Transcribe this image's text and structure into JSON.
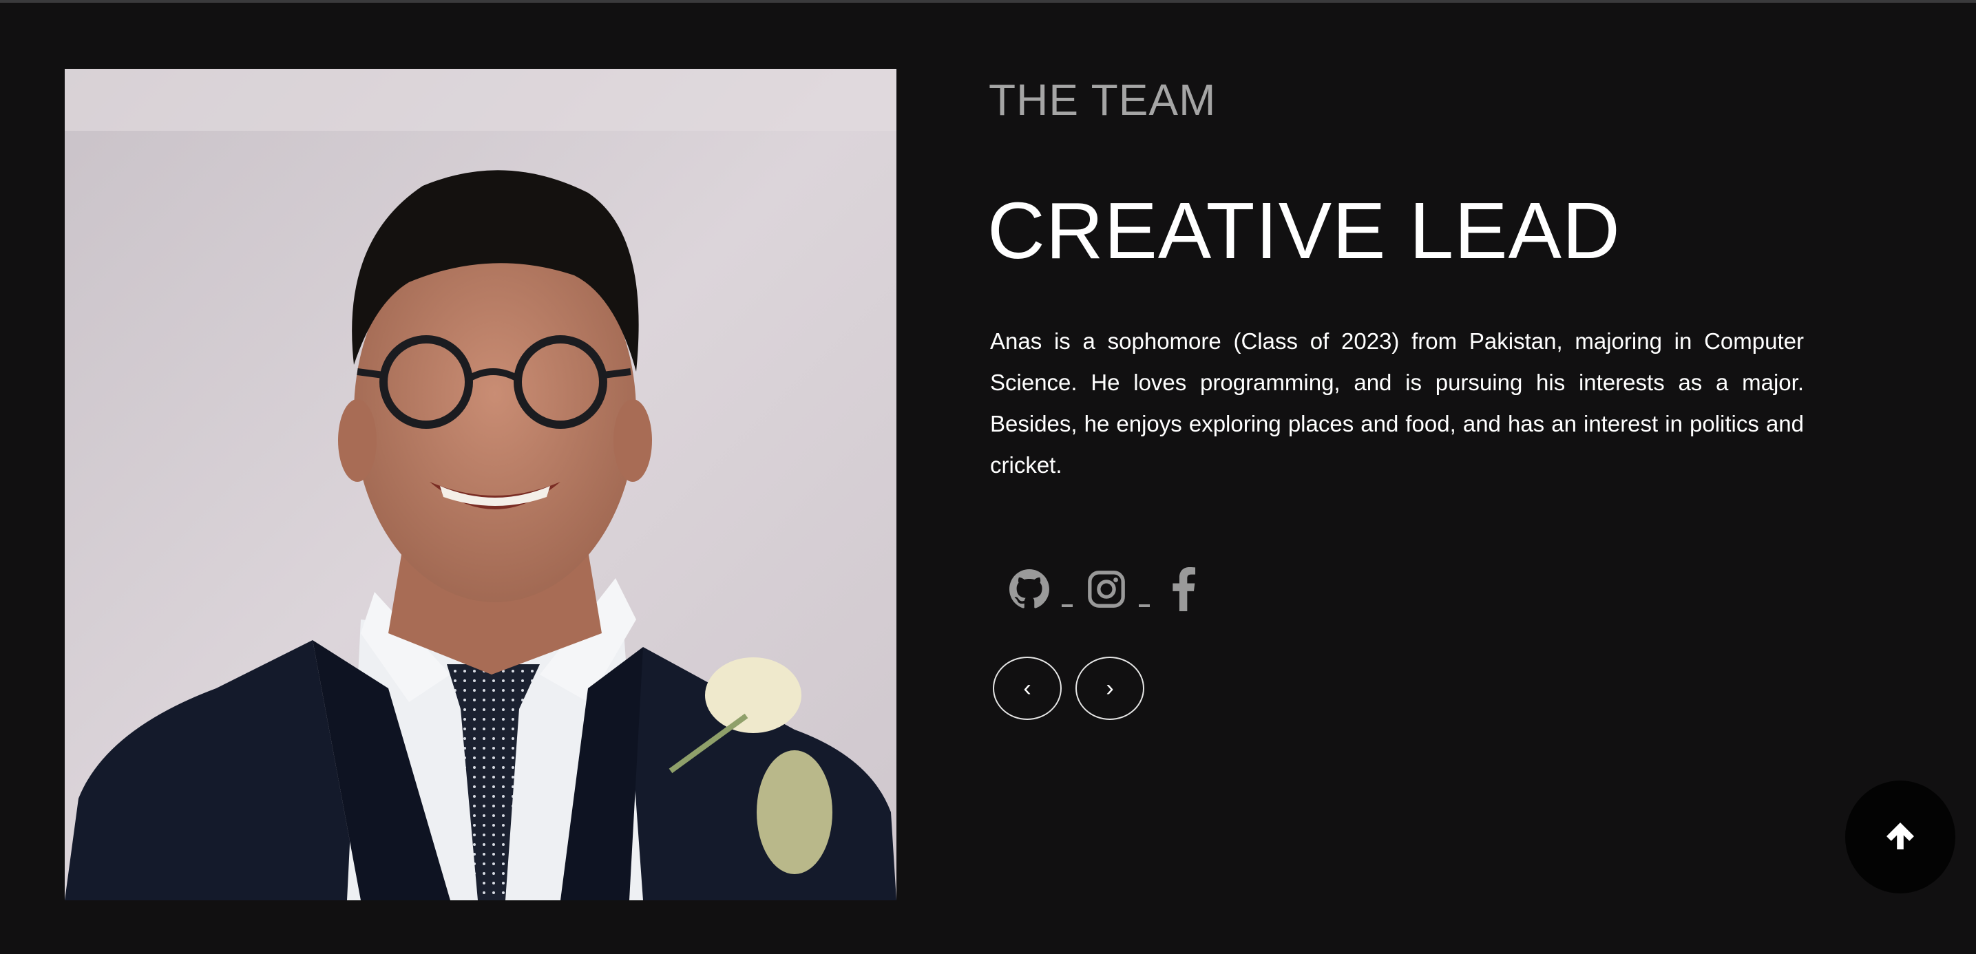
{
  "section": {
    "eyebrow": "THE TEAM"
  },
  "member": {
    "role": "CREATIVE LEAD",
    "bio": "Anas is a sophomore (Class of 2023) from Pakistan, majoring in Computer Science. He loves programming, and is pursuing his interests as a major. Besides, he enjoys exploring places and food, and has an interest in politics and cricket."
  },
  "socials": [
    {
      "icon": "github-icon"
    },
    {
      "icon": "instagram-icon"
    },
    {
      "icon": "facebook-icon"
    }
  ],
  "navigation": {
    "prev_glyph": "‹",
    "next_glyph": "›"
  },
  "scroll_top": {
    "icon": "arrow-up-icon"
  },
  "colors": {
    "background": "#111011",
    "eyebrow": "#a5a5a5",
    "text": "#ffffff",
    "icon": "#9a9a9a",
    "scroll_button": "#030303"
  }
}
